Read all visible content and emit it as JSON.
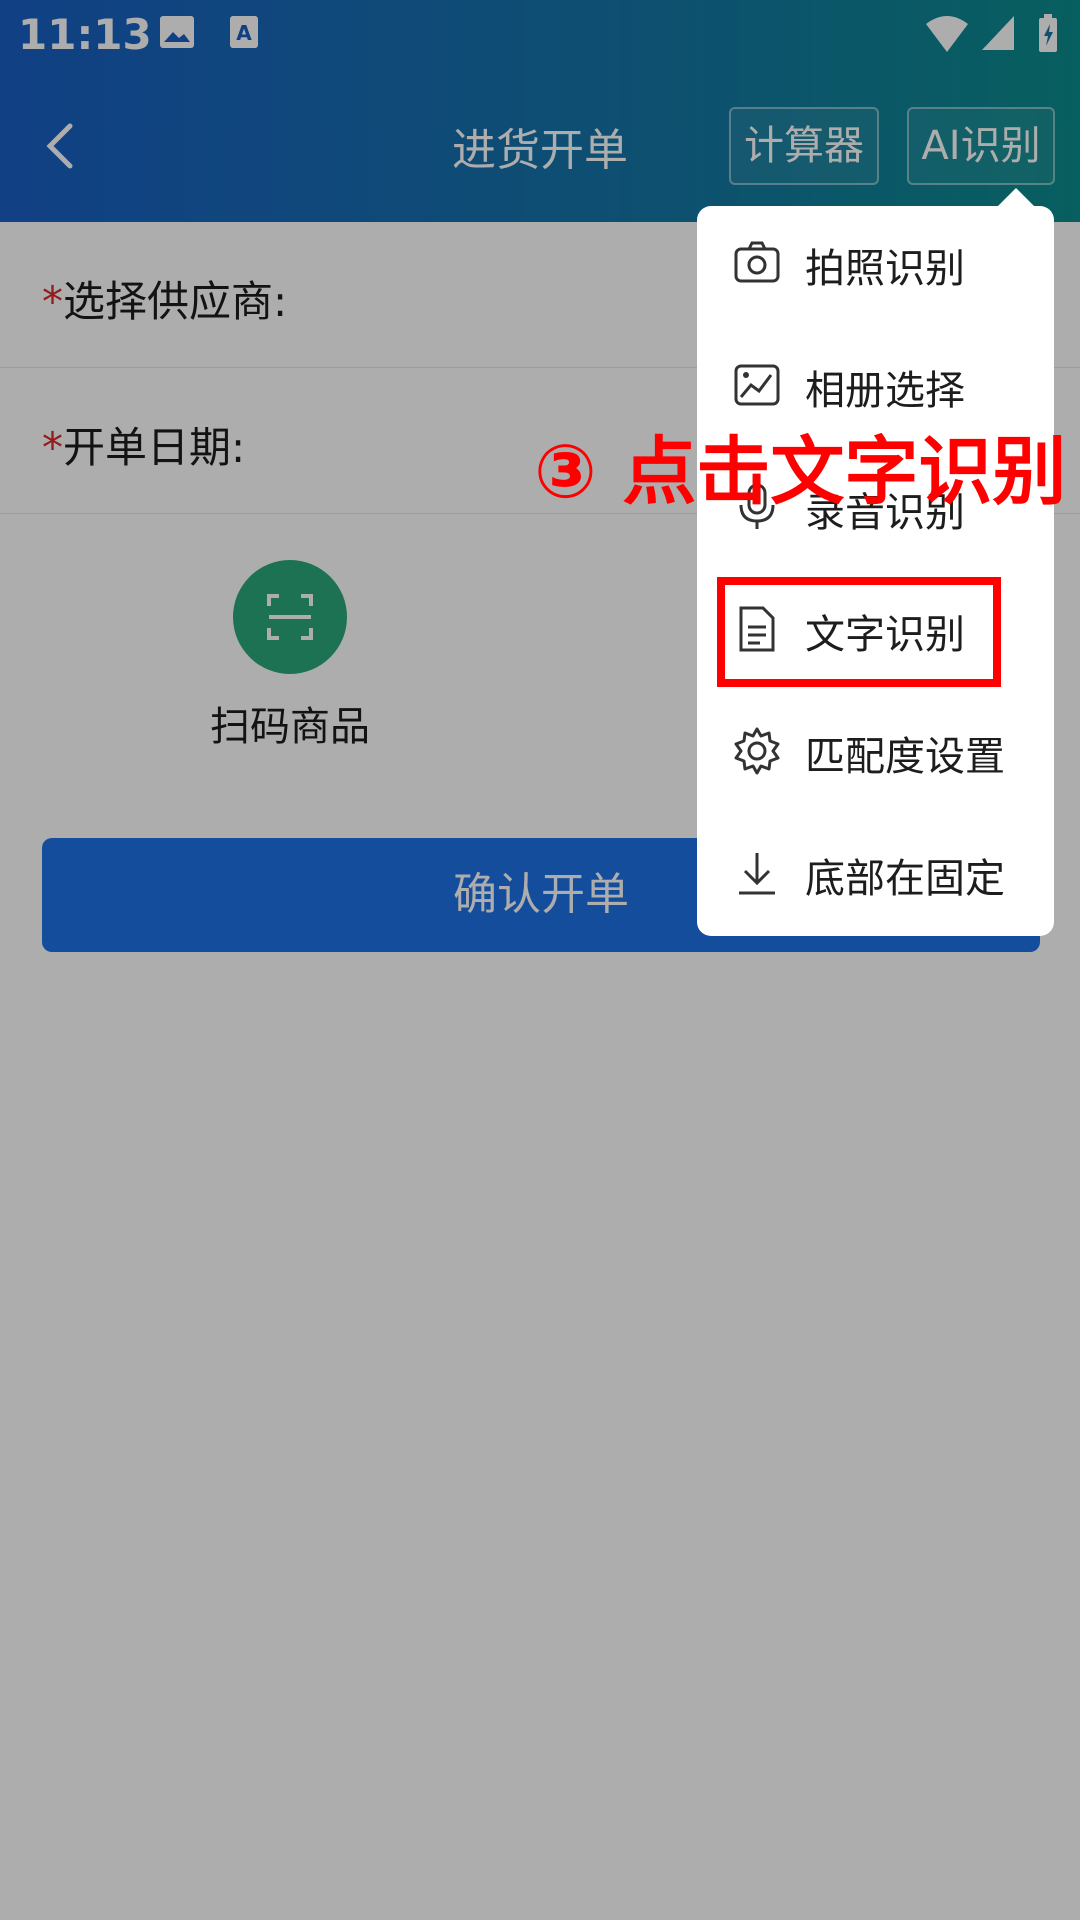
{
  "status_bar": {
    "time": "11:13"
  },
  "header": {
    "title": "进货开单",
    "calculator_label": "计算器",
    "ai_label": "AI识别"
  },
  "form": {
    "supplier_label": "选择供应商:",
    "date_label": "开单日期:",
    "required_mark": "*"
  },
  "scan": {
    "label": "扫码商品"
  },
  "confirm_label": "确认开单",
  "menu": {
    "items": [
      {
        "label": "拍照识别",
        "icon": "camera-icon"
      },
      {
        "label": "相册选择",
        "icon": "gallery-icon"
      },
      {
        "label": "录音识别",
        "icon": "microphone-icon"
      },
      {
        "label": "文字识别",
        "icon": "document-icon"
      },
      {
        "label": "匹配度设置",
        "icon": "gear-icon"
      },
      {
        "label": "底部在固定",
        "icon": "download-icon"
      }
    ]
  },
  "annotation": "③ 点击文字识别",
  "colors": {
    "header": "#1a5fc4",
    "confirm": "#1f72e8",
    "scan": "#2aa87a",
    "highlight": "#ff0000"
  }
}
